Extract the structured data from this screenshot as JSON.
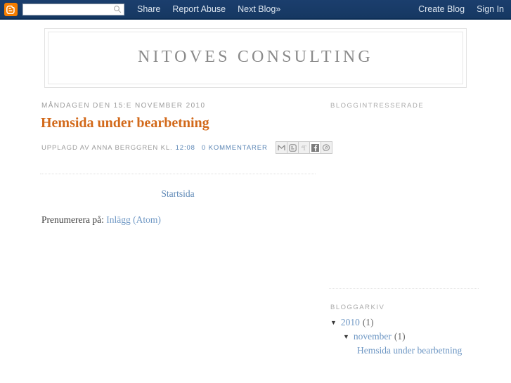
{
  "navbar": {
    "logo_icon": "blogger-b-icon",
    "search": {
      "value": "",
      "placeholder": "",
      "icon": "search-icon"
    },
    "links": [
      {
        "label": "Share"
      },
      {
        "label": "Report Abuse"
      },
      {
        "label": "Next Blog»"
      }
    ],
    "right_links": [
      {
        "label": "Create Blog"
      },
      {
        "label": "Sign In"
      }
    ],
    "background_color": "#1c3f6e"
  },
  "header": {
    "blog_title": "NITOVES CONSULTING"
  },
  "post": {
    "date": "MÅNDAGEN DEN 15:E NOVEMBER 2010",
    "title": "Hemsida under bearbetning",
    "title_color": "#d2691a",
    "meta_author": "UPPLAGD AV ANNA BERGGREN KL.",
    "meta_time": "12:08",
    "meta_comments": "0 KOMMENTARER",
    "share_icons": [
      {
        "name": "gmail-share-icon",
        "glyph": "M"
      },
      {
        "name": "blogger-share-icon",
        "glyph": "B"
      },
      {
        "name": "twitter-share-icon",
        "glyph": "t"
      },
      {
        "name": "facebook-share-icon",
        "glyph": "f"
      },
      {
        "name": "pinterest-share-icon",
        "glyph": "P"
      }
    ]
  },
  "pager": {
    "home_label": "Startsida"
  },
  "feed": {
    "prefix": "Prenumerera på:",
    "link_label": "Inlägg (Atom)"
  },
  "sidebar": {
    "followers_heading": "BLOGGINTRESSERADE",
    "archive_heading": "BLOGGARKIV",
    "archive": {
      "year": {
        "label": "2010",
        "count": "(1)",
        "arrow": "▼"
      },
      "month": {
        "label": "november",
        "count": "(1)",
        "arrow": "▼"
      },
      "posts": [
        {
          "label": "Hemsida under bearbetning"
        }
      ]
    }
  }
}
